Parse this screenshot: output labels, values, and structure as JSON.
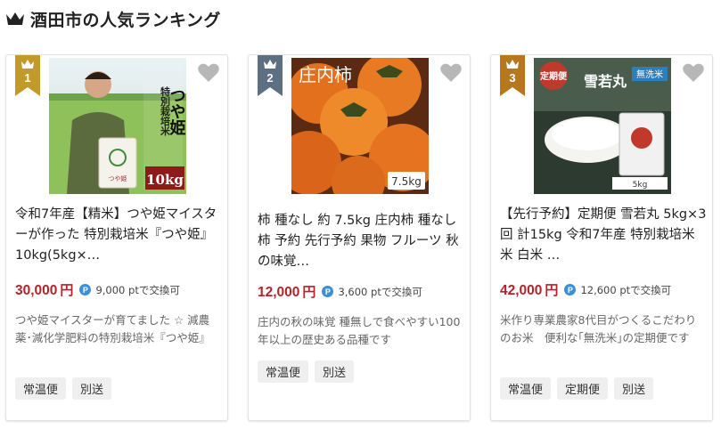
{
  "page_title": "酒田市の人気ランキング",
  "icons": {
    "header": "crown-icon",
    "favorite": "heart-icon",
    "point": "point-icon"
  },
  "colors": {
    "gold": "#c19a2b",
    "slate": "#5d6f82",
    "bronze": "#b5781f",
    "price": "#b4232a",
    "point": "#3d8fd6"
  },
  "point_mark": "P",
  "items": [
    {
      "rank": "1",
      "image_text": {
        "brand": "つや姫",
        "weight": "10kg",
        "label": "特別栽培米"
      },
      "title": "令和7年産【精米】つや姫マイスターが作った 特別栽培米『つや姫』10kg(5kg×…",
      "price": "30,000",
      "yen": "円",
      "points": "9,000 ptで交換可",
      "description": "つや姫マイスターが育てました ☆ 減農薬･減化学肥料の特別栽培米『つや姫』",
      "tags": [
        "常温便",
        "別送"
      ]
    },
    {
      "rank": "2",
      "image_text": {
        "brand": "庄内柿",
        "weight": "7.5kg"
      },
      "title": "柿 種なし 約 7.5kg 庄内柿 種なし柿 予約 先行予約 果物 フルーツ 秋の味覚…",
      "price": "12,000",
      "yen": "円",
      "points": "3,600 ptで交換可",
      "description": "庄内の秋の味覚 種無しで食べやすい100年以上の歴史ある品種です",
      "tags": [
        "常温便",
        "別送"
      ]
    },
    {
      "rank": "3",
      "image_text": {
        "brand": "雪若丸",
        "badge": "定期便",
        "label": "無洗米",
        "weight": "5kg"
      },
      "title": "【先行予約】定期便 雪若丸 5kg×3回 計15kg 令和7年産 特別栽培米 米 白米 …",
      "price": "42,000",
      "yen": "円",
      "points": "12,600 ptで交換可",
      "description": "米作り専業農家8代目がつくるこだわりのお米　便利な｢無洗米｣の定期便です",
      "tags": [
        "常温便",
        "定期便",
        "別送"
      ]
    }
  ]
}
